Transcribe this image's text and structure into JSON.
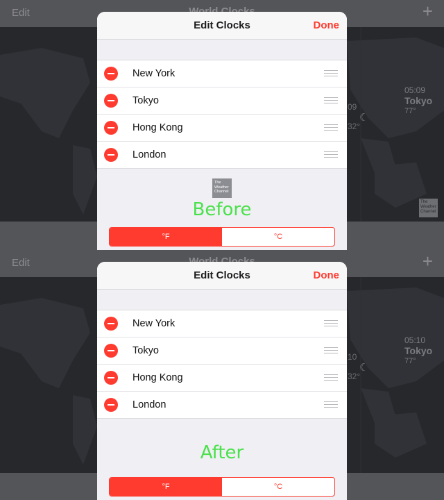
{
  "before": {
    "background": {
      "edit_label": "Edit",
      "title": "World Clocks",
      "add_label": "+",
      "clock_time": "05:09",
      "clock_city": "Tokyo",
      "clock_temp": "77°",
      "partial_time": "09",
      "partial_temp": "32°",
      "weather_logo_text": "The Weather Channel"
    },
    "sheet": {
      "title": "Edit Clocks",
      "done_label": "Done",
      "cities": [
        "New York",
        "Tokyo",
        "Hong Kong",
        "London"
      ],
      "weather_logo_text": "The Weather Channel",
      "unit_f": "°F",
      "unit_c": "°C",
      "selected_unit": "°F"
    },
    "caption": "Before"
  },
  "after": {
    "background": {
      "edit_label": "Edit",
      "title": "World Clocks",
      "add_label": "+",
      "clock_time": "05:10",
      "clock_city": "Tokyo",
      "clock_temp": "77°",
      "partial_time": "10",
      "partial_temp": "32°"
    },
    "sheet": {
      "title": "Edit Clocks",
      "done_label": "Done",
      "cities": [
        "New York",
        "Tokyo",
        "Hong Kong",
        "London"
      ],
      "unit_f": "°F",
      "unit_c": "°C",
      "selected_unit": "°F"
    },
    "caption": "After"
  },
  "colors": {
    "accent": "#ff3b30",
    "caption": "#4be14b"
  }
}
